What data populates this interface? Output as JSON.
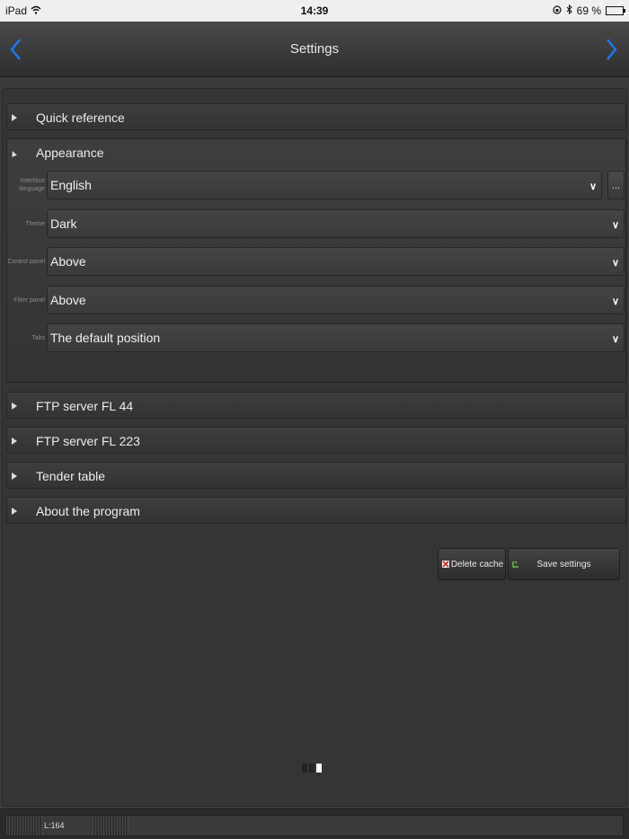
{
  "status_bar": {
    "device": "iPad",
    "time": "14:39",
    "battery": "69 %",
    "battery_level": 0.69
  },
  "navbar": {
    "title": "Settings"
  },
  "sections": {
    "quick_reference": "Quick reference",
    "appearance": "Appearance",
    "ftp_44": "FTP server FL 44",
    "ftp_223": "FTP server FL 223",
    "tender_table": "Tender table",
    "about": "About the program"
  },
  "appearance": {
    "interface_language": {
      "label": "Interface language",
      "value": "English",
      "more": "..."
    },
    "theme": {
      "label": "Theme",
      "value": "Dark"
    },
    "control_panel": {
      "label": "Control panel",
      "value": "Above"
    },
    "filter_panel": {
      "label": "Filter panel",
      "value": "Above"
    },
    "tabs": {
      "label": "Tabs",
      "value": "The default position"
    }
  },
  "actions": {
    "delete_cache": "Delete cache",
    "save_settings": "Save settings"
  },
  "footer": {
    "label": "L:164"
  },
  "colors": {
    "accent": "#1a7cf0",
    "background": "#353535"
  },
  "icons": [
    "wifi-icon",
    "chevron-left-icon",
    "chevron-right-icon",
    "triangle-icon",
    "chevron-down-icon",
    "delete-icon",
    "save-icon"
  ]
}
